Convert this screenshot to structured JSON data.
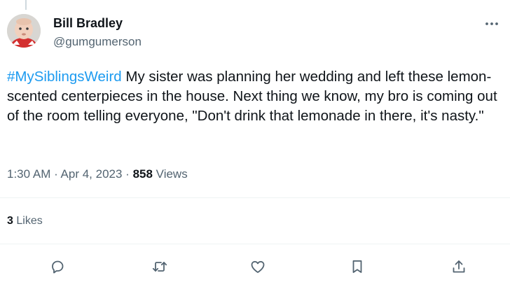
{
  "tweet": {
    "author": {
      "name": "Bill Bradley",
      "handle": "@gumgumerson"
    },
    "hashtag": "#MySiblingsWeird",
    "body": " My sister was planning her wedding and left these lemon-scented centerpieces in the house. Next thing we know, my bro is coming out of the room telling everyone, \"Don't drink that lemonade in there, it's nasty.\"",
    "time": "1:30 AM",
    "separator": " · ",
    "date": "Apr 4, 2023",
    "views_count": "858",
    "views_label": "Views",
    "likes_count": "3",
    "likes_label": "Likes"
  },
  "actions": {
    "icons": [
      "reply-icon",
      "retweet-icon",
      "like-icon",
      "bookmark-icon",
      "share-icon"
    ]
  },
  "colors": {
    "accent": "#1d9bf0",
    "text": "#0f1419",
    "secondary_text": "#536471",
    "divider": "#eff3f4"
  }
}
